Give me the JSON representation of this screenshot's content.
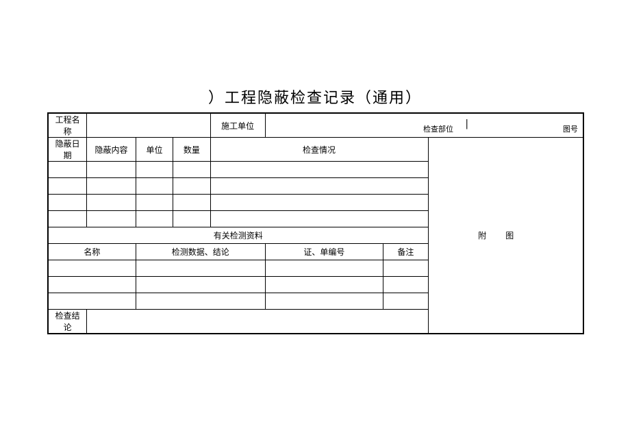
{
  "title": "）工程隐蔽检查记录（通用）",
  "row1": {
    "label1": "工程名称",
    "label2": "施工单位"
  },
  "row2": {
    "hiddenDate": "隐蔽日期",
    "hiddenContent": "隐蔽内容",
    "unit": "单位",
    "qty": "数量",
    "inspection": "检查情况",
    "attached": "附图"
  },
  "sectionTitle": "有关检测资料",
  "dataHeaders": {
    "name": "名称",
    "result": "检测数据、结论",
    "cert": "证、单编号",
    "remark": "备注"
  },
  "conclusion": "检查结论",
  "meta1": "检查部位",
  "meta2": "图号",
  "cursor": "|"
}
